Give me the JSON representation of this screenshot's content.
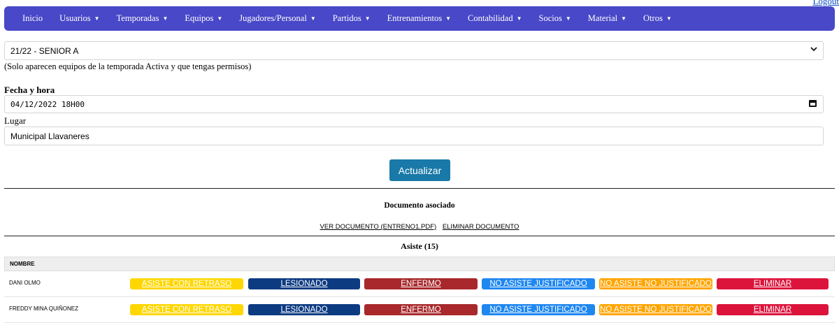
{
  "header": {
    "logout": "Logout"
  },
  "nav": {
    "items": [
      {
        "label": "Inicio",
        "caret": false
      },
      {
        "label": "Usuarios",
        "caret": true
      },
      {
        "label": "Temporadas",
        "caret": true
      },
      {
        "label": "Equipos",
        "caret": true
      },
      {
        "label": "Jugadores/Personal",
        "caret": true
      },
      {
        "label": "Partidos",
        "caret": true
      },
      {
        "label": "Entrenamientos",
        "caret": true
      },
      {
        "label": "Contabilidad",
        "caret": true
      },
      {
        "label": "Socios",
        "caret": true
      },
      {
        "label": "Material",
        "caret": true
      },
      {
        "label": "Otros",
        "caret": true
      }
    ],
    "caret_glyph": "▼",
    "color": "#4848c8"
  },
  "form": {
    "team_select": "21/22 - SENIOR A",
    "team_hint": "(Solo aparecen equipos de la temporada Activa y que tengas permisos)",
    "datetime_label": "Fecha y hora",
    "datetime_value": "04/12/2022 18H00",
    "place_label": "Lugar",
    "place_value": "Municipal Llavaneres",
    "update_button": "Actualizar"
  },
  "document": {
    "title": "Documento asociado",
    "view_link": "VER DOCUMENTO (ENTRENO1.PDF)",
    "delete_link": "ELIMINAR DOCUMENTO"
  },
  "attendance": {
    "title": "Asiste (15)",
    "column_header": "NOMBRE",
    "actions": [
      {
        "label": "ASISTE CON RETRASO",
        "color": "#ffd700"
      },
      {
        "label": "LESIONADO",
        "color": "#0d3b82"
      },
      {
        "label": "ENFERMO",
        "color": "#a8282b"
      },
      {
        "label": "NO ASISTE JUSTIFICADO",
        "color": "#1e87f0"
      },
      {
        "label": "NO ASISTE NO JUSTIFICADO",
        "color": "#ffa500"
      },
      {
        "label": "ELIMINAR",
        "color": "#dc143c"
      }
    ],
    "rows": [
      {
        "name": "DANI OLMO"
      },
      {
        "name": "FREDDY MINA QUIÑONEZ"
      }
    ]
  }
}
